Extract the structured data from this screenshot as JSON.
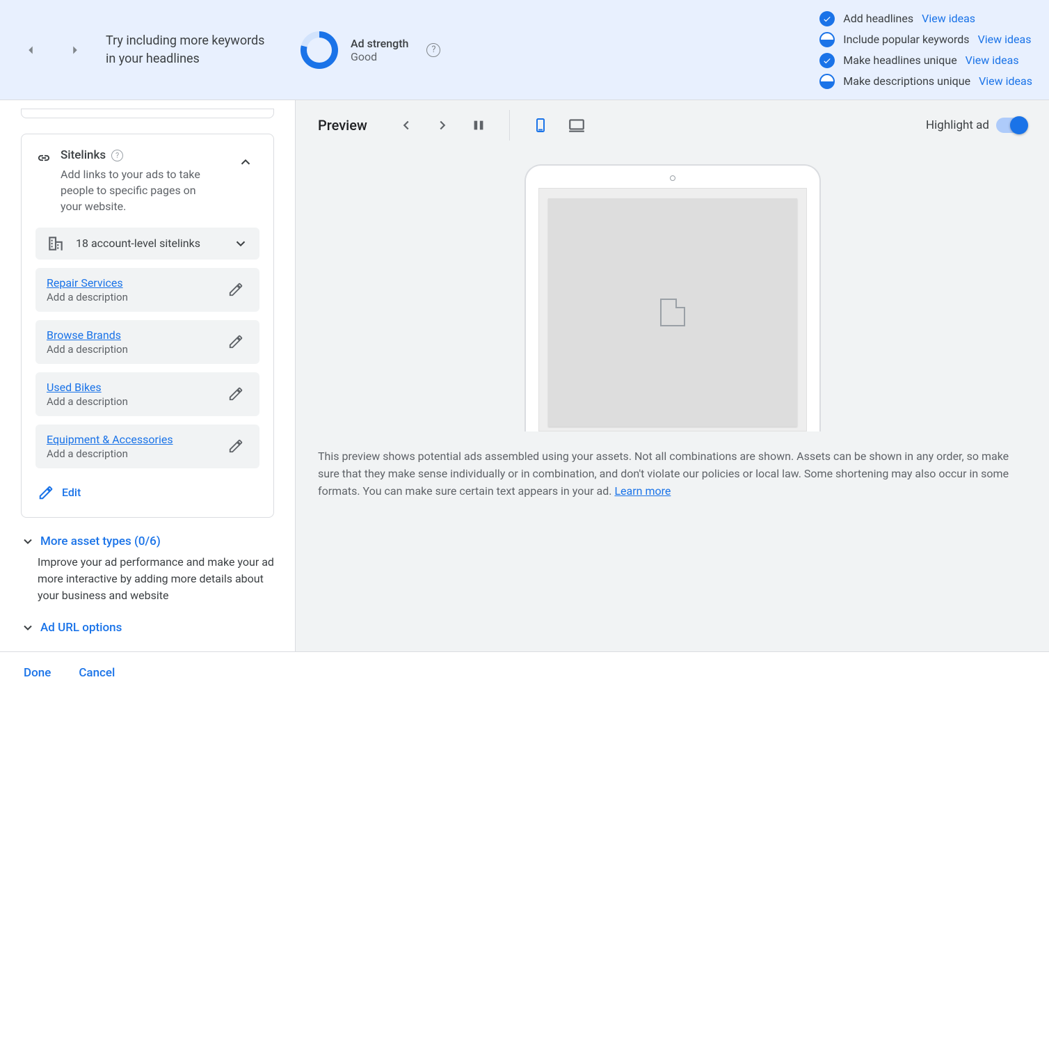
{
  "header": {
    "tip": "Try including more keywords in your headlines",
    "strength_label": "Ad strength",
    "strength_value": "Good"
  },
  "checklist": [
    {
      "done": true,
      "label": "Add headlines",
      "action": "View ideas"
    },
    {
      "done": false,
      "label": "Include popular keywords",
      "action": "View ideas"
    },
    {
      "done": true,
      "label": "Make headlines unique",
      "action": "View ideas"
    },
    {
      "done": false,
      "label": "Make descriptions unique",
      "action": "View ideas"
    }
  ],
  "sitelinks": {
    "title": "Sitelinks",
    "description": "Add links to your ads to take people to specific pages on your website.",
    "account_level": "18 account-level sitelinks",
    "items": [
      {
        "title": "Repair Services",
        "sub": "Add a description"
      },
      {
        "title": "Browse Brands",
        "sub": "Add a description"
      },
      {
        "title": "Used Bikes",
        "sub": "Add a description"
      },
      {
        "title": "Equipment & Accessories",
        "sub": "Add a description"
      }
    ],
    "edit": "Edit"
  },
  "more_assets": {
    "label": "More asset types (0/6)",
    "desc": "Improve your ad performance and make your ad more interactive by adding more details about your business and website"
  },
  "ad_url_options": "Ad URL options",
  "preview": {
    "label": "Preview",
    "highlight_label": "Highlight ad",
    "note": "This preview shows potential ads assembled using your assets. Not all combinations are shown. Assets can be shown in any order, so make sure that they make sense individually or in combination, and don't violate our policies or local law. Some shortening may also occur in some formats. You can make sure certain text appears in your ad. ",
    "learn_more": "Learn more"
  },
  "footer": {
    "done": "Done",
    "cancel": "Cancel"
  }
}
